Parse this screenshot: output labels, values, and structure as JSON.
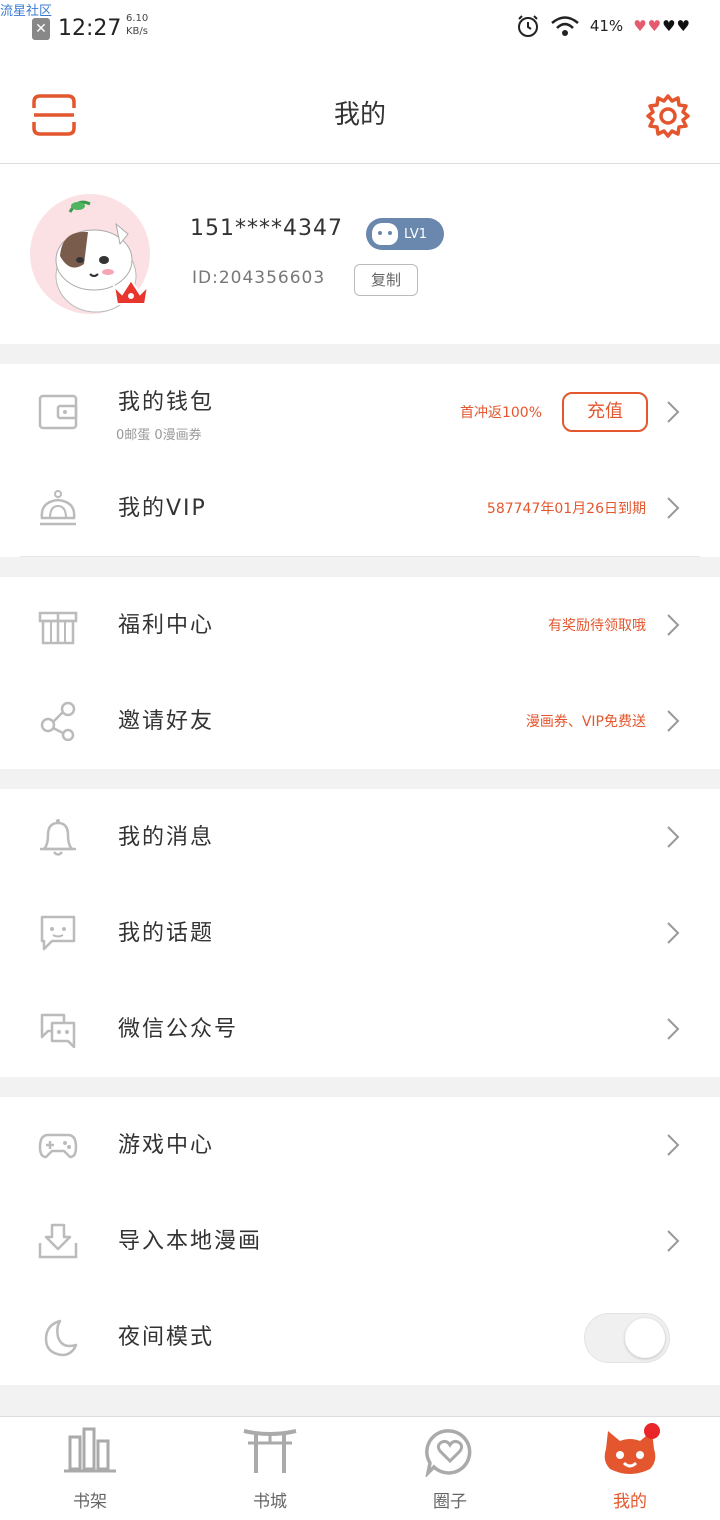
{
  "watermark": "流星社区",
  "status": {
    "time": "12:27",
    "speed_top": "6.10",
    "speed_bottom": "KB/s",
    "battery": "41%"
  },
  "header": {
    "title": "我的"
  },
  "profile": {
    "username": "151****4347",
    "level": "LV1",
    "uid": "ID:204356603",
    "copy_label": "复制"
  },
  "wallet": {
    "label": "我的钱包",
    "sub": "0邮蛋 0漫画券",
    "promo": "首冲返100%",
    "recharge_label": "充值"
  },
  "vip": {
    "label": "我的VIP",
    "note": "587747年01月26日到期"
  },
  "welfare": {
    "label": "福利中心",
    "note": "有奖励待领取哦"
  },
  "invite": {
    "label": "邀请好友",
    "note": "漫画券、VIP免费送"
  },
  "messages": {
    "label": "我的消息"
  },
  "topics": {
    "label": "我的话题"
  },
  "wechat": {
    "label": "微信公众号"
  },
  "games": {
    "label": "游戏中心"
  },
  "import": {
    "label": "导入本地漫画"
  },
  "night": {
    "label": "夜间模式"
  },
  "nav": {
    "items": [
      {
        "label": "书架"
      },
      {
        "label": "书城"
      },
      {
        "label": "圈子"
      },
      {
        "label": "我的"
      }
    ]
  },
  "colors": {
    "accent": "#e4572e",
    "badge": "#6a87ad"
  }
}
